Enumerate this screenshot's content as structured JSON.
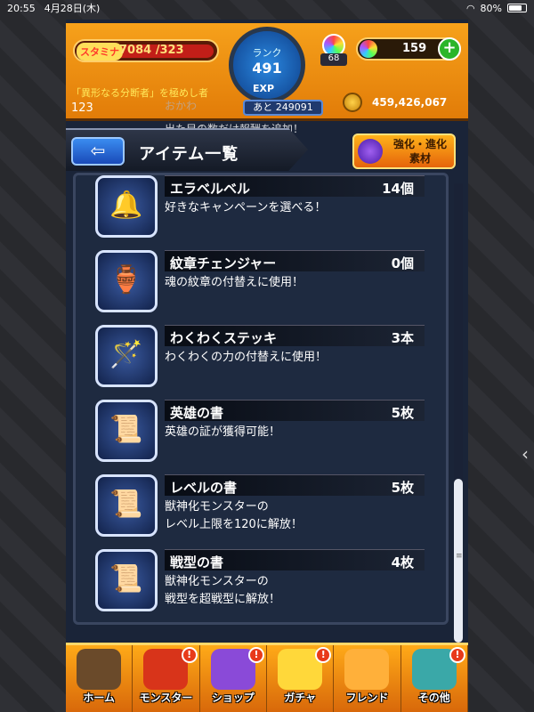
{
  "status": {
    "time": "20:55",
    "date": "4月28日(木)",
    "battery": "80%"
  },
  "header": {
    "stamina_label": "スタミナ",
    "stamina_value": "7084 /323",
    "rank_label": "ランク",
    "rank_value": "491",
    "exp_label": "EXP",
    "exp_remaining": "あと 249091",
    "orb_badge": "68",
    "gem_count": "159",
    "plus_label": "+",
    "player_title": "「異形なる分断者」を極めし者",
    "player_number": "123",
    "gold": "459,426,067",
    "behind_text_1": "おかわ",
    "behind_text_2": "出た目の数だけ報酬を追加！"
  },
  "titlebar": {
    "back_label": "⇦",
    "title": "アイテム一覧",
    "evolve_label": "強化・進化\n素材"
  },
  "items": [
    {
      "name": "エラベルベル",
      "qty": "14個",
      "desc": "好きなキャンペーンを選べる！",
      "icon": "🔔"
    },
    {
      "name": "紋章チェンジャー",
      "qty": "0個",
      "desc": "魂の紋章の付替えに使用！",
      "icon": "🏺"
    },
    {
      "name": "わくわくステッキ",
      "qty": "3本",
      "desc": "わくわくの力の付替えに使用！",
      "icon": "🪄"
    },
    {
      "name": "英雄の書",
      "qty": "5枚",
      "desc": "英雄の証が獲得可能！",
      "icon": "📜"
    },
    {
      "name": "レベルの書",
      "qty": "5枚",
      "desc": "獣神化モンスターの\nレベル上限を120に解放！",
      "icon": "📜"
    },
    {
      "name": "戦型の書",
      "qty": "4枚",
      "desc": "獣神化モンスターの\n戦型を超戦型に解放！",
      "icon": "📜"
    }
  ],
  "nav": [
    {
      "label": "ホーム",
      "alert": ""
    },
    {
      "label": "モンスター",
      "alert": "!"
    },
    {
      "label": "ショップ",
      "alert": "!"
    },
    {
      "label": "ガチャ",
      "alert": "!"
    },
    {
      "label": "フレンド",
      "alert": ""
    },
    {
      "label": "その他",
      "alert": "!"
    }
  ],
  "scroll_position": 0.64
}
